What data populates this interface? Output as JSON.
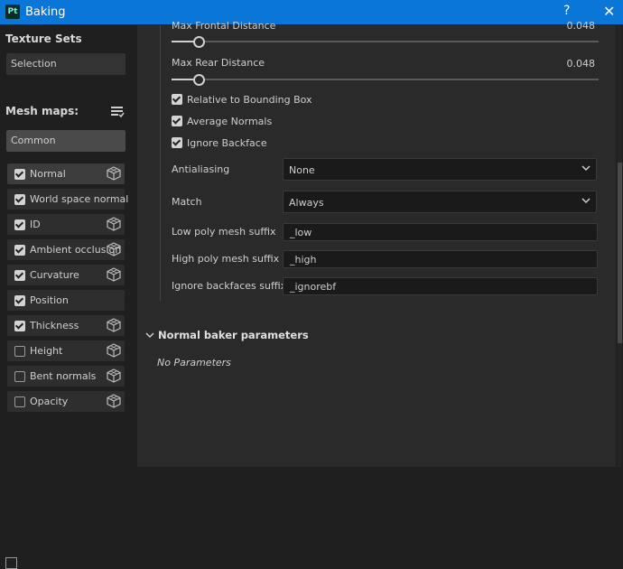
{
  "window": {
    "app_logo": "Pt",
    "title": "Baking",
    "help_label": "?",
    "close_label": "✕"
  },
  "texture_sets": {
    "heading": "Texture Sets",
    "selected": "Selection"
  },
  "mesh_maps": {
    "heading": "Mesh maps:",
    "filter": "Common",
    "items": [
      {
        "label": "Normal",
        "checked": true,
        "has_icon": true,
        "selected": true
      },
      {
        "label": "World space normal",
        "checked": true,
        "has_icon": false
      },
      {
        "label": "ID",
        "checked": true,
        "has_icon": true
      },
      {
        "label": "Ambient occlusion",
        "checked": true,
        "has_icon": true
      },
      {
        "label": "Curvature",
        "checked": true,
        "has_icon": true
      },
      {
        "label": "Position",
        "checked": true,
        "has_icon": false
      },
      {
        "label": "Thickness",
        "checked": true,
        "has_icon": true
      },
      {
        "label": "Height",
        "checked": false,
        "has_icon": true
      },
      {
        "label": "Bent normals",
        "checked": false,
        "has_icon": true
      },
      {
        "label": "Opacity",
        "checked": false,
        "has_icon": true
      }
    ]
  },
  "params": {
    "max_frontal": {
      "label": "Max Frontal Distance",
      "value": "0.048",
      "level": 0.06
    },
    "max_rear": {
      "label": "Max Rear Distance",
      "value": "0.048",
      "level": 0.06
    },
    "relative_bbox": {
      "label": "Relative to Bounding Box",
      "checked": true
    },
    "average_normals": {
      "label": "Average Normals",
      "checked": true
    },
    "ignore_backface": {
      "label": "Ignore Backface",
      "checked": true
    },
    "antialiasing": {
      "label": "Antialiasing",
      "value": "None"
    },
    "match": {
      "label": "Match",
      "value": "Always"
    },
    "low_poly_suffix": {
      "label": "Low poly mesh suffix",
      "value": "_low"
    },
    "high_poly_suffix": {
      "label": "High poly mesh suffix",
      "value": "_high"
    },
    "ignore_backfaces_suffix": {
      "label": "Ignore backfaces suffix",
      "value": "_ignorebf"
    }
  },
  "normal_baker": {
    "heading": "Normal baker parameters",
    "empty_text": "No Parameters"
  },
  "colors": {
    "titlebar": "#0a76d8",
    "panel": "#2a2a2a",
    "background": "#1f1f1f"
  }
}
